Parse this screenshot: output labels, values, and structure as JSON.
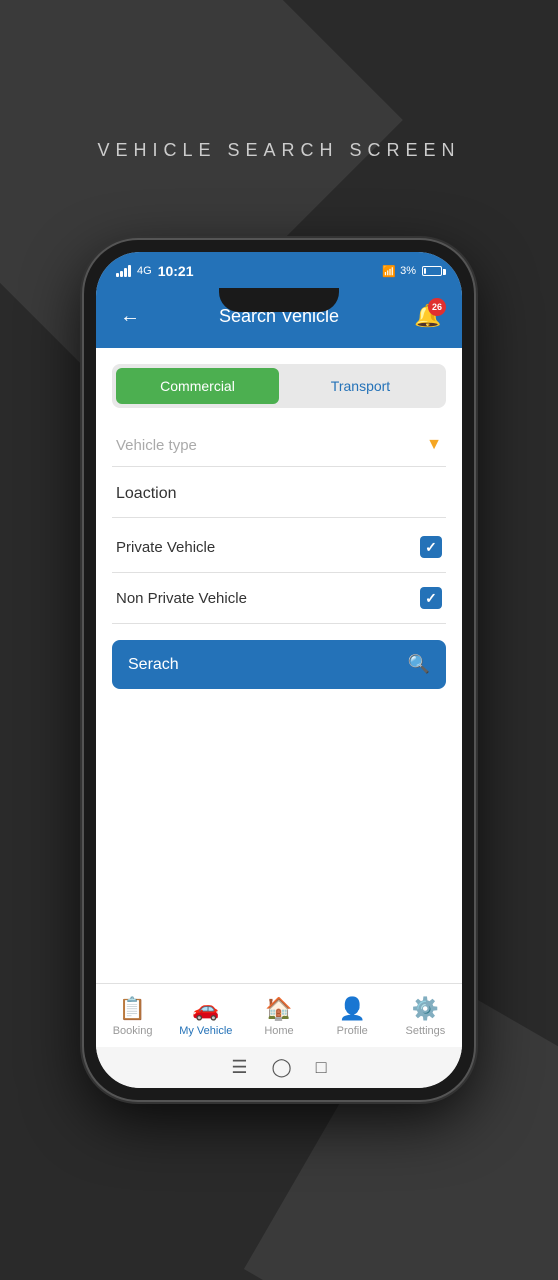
{
  "screen": {
    "label": "VEHICLE SEARCH SCREEN"
  },
  "statusBar": {
    "time": "10:21",
    "signal": "4G",
    "wifi": "WiFi",
    "battery": "3%"
  },
  "header": {
    "title": "Search Vehicle",
    "backLabel": "←",
    "notifCount": "26"
  },
  "tabs": [
    {
      "id": "commercial",
      "label": "Commercial",
      "active": true
    },
    {
      "id": "transport",
      "label": "Transport",
      "active": false
    }
  ],
  "vehicleTypeDropdown": {
    "placeholder": "Vehicle type"
  },
  "locationRow": {
    "text": "Loaction"
  },
  "checkboxes": [
    {
      "id": "private",
      "label": "Private Vehicle",
      "checked": true
    },
    {
      "id": "non-private",
      "label": "Non Private Vehicle",
      "checked": true
    }
  ],
  "searchButton": {
    "label": "Serach"
  },
  "bottomNav": [
    {
      "id": "booking",
      "icon": "📋",
      "label": "Booking",
      "active": false
    },
    {
      "id": "my-vehicle",
      "icon": "🚗",
      "label": "My Vehicle",
      "active": true
    },
    {
      "id": "home",
      "icon": "🏠",
      "label": "Home",
      "active": false
    },
    {
      "id": "profile",
      "icon": "👤",
      "label": "Profile",
      "active": false
    },
    {
      "id": "settings",
      "icon": "⚙️",
      "label": "Settings",
      "active": false
    }
  ]
}
